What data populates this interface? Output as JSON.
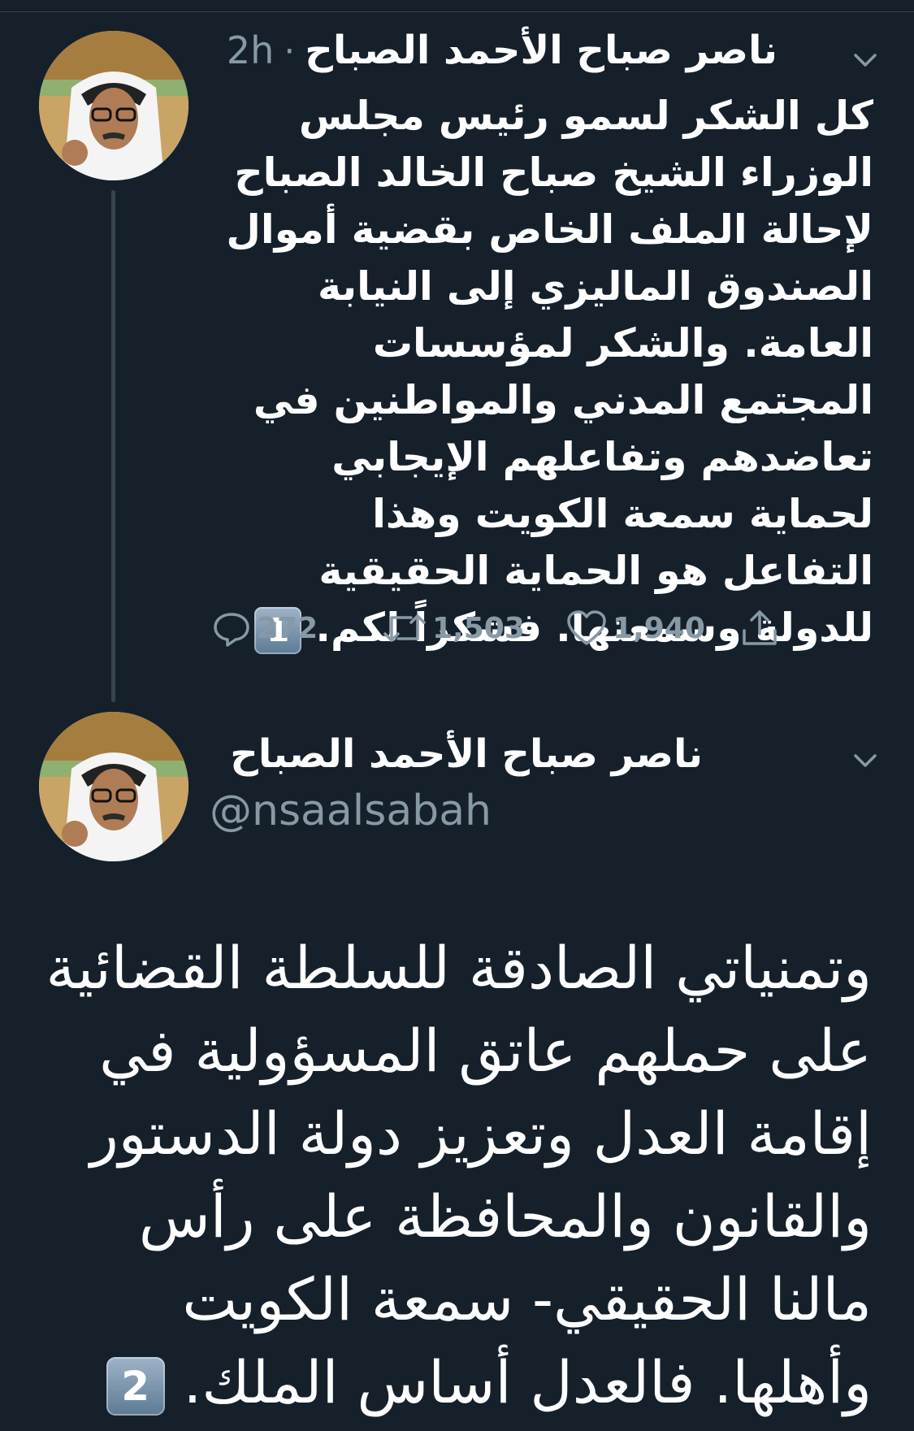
{
  "tweet1": {
    "author_name": "ناصر صباح الأحمد الصباح",
    "separator": "·",
    "time": "2h",
    "text": "كل الشكر لسمو رئيس مجلس الوزراء الشيخ صباح الخالد الصباح لإحالة الملف الخاص بقضية أموال الصندوق الماليزي إلى النيابة العامة. والشكر لمؤسسات  المجتمع المدني والمواطنين في تعاضدهم وتفاعلهم الإيجابي لحماية سمعة الكويت وهذا التفاعل هو الحماية الحقيقية للدولة وسمعتها. فشكراً لكم.",
    "keycap": "1",
    "reply_count": "272",
    "retweet_count": "1,503",
    "like_count": "1,940"
  },
  "tweet2": {
    "author_name": "ناصر صباح الأحمد الصباح",
    "handle": "@nsaalsabah",
    "text": "وتمنياتي الصادقة للسلطة القضائية على حملهم عاتق المسؤولية في إقامة العدل وتعزيز دولة الدستور والقانون والمحافظة على رأس مالنا الحقيقي- سمعة الكويت وأهلها. فالعدل أساس الملك.",
    "keycap": "2"
  },
  "colors": {
    "background": "#15202b",
    "text": "#ffffff",
    "secondary": "#8899a6",
    "thread_line": "#38444d"
  },
  "icons": {
    "reply": "speech-bubble-icon",
    "retweet": "retweet-arrows-icon",
    "like": "heart-icon",
    "share": "share-upload-icon",
    "menu": "chevron-down-icon"
  }
}
